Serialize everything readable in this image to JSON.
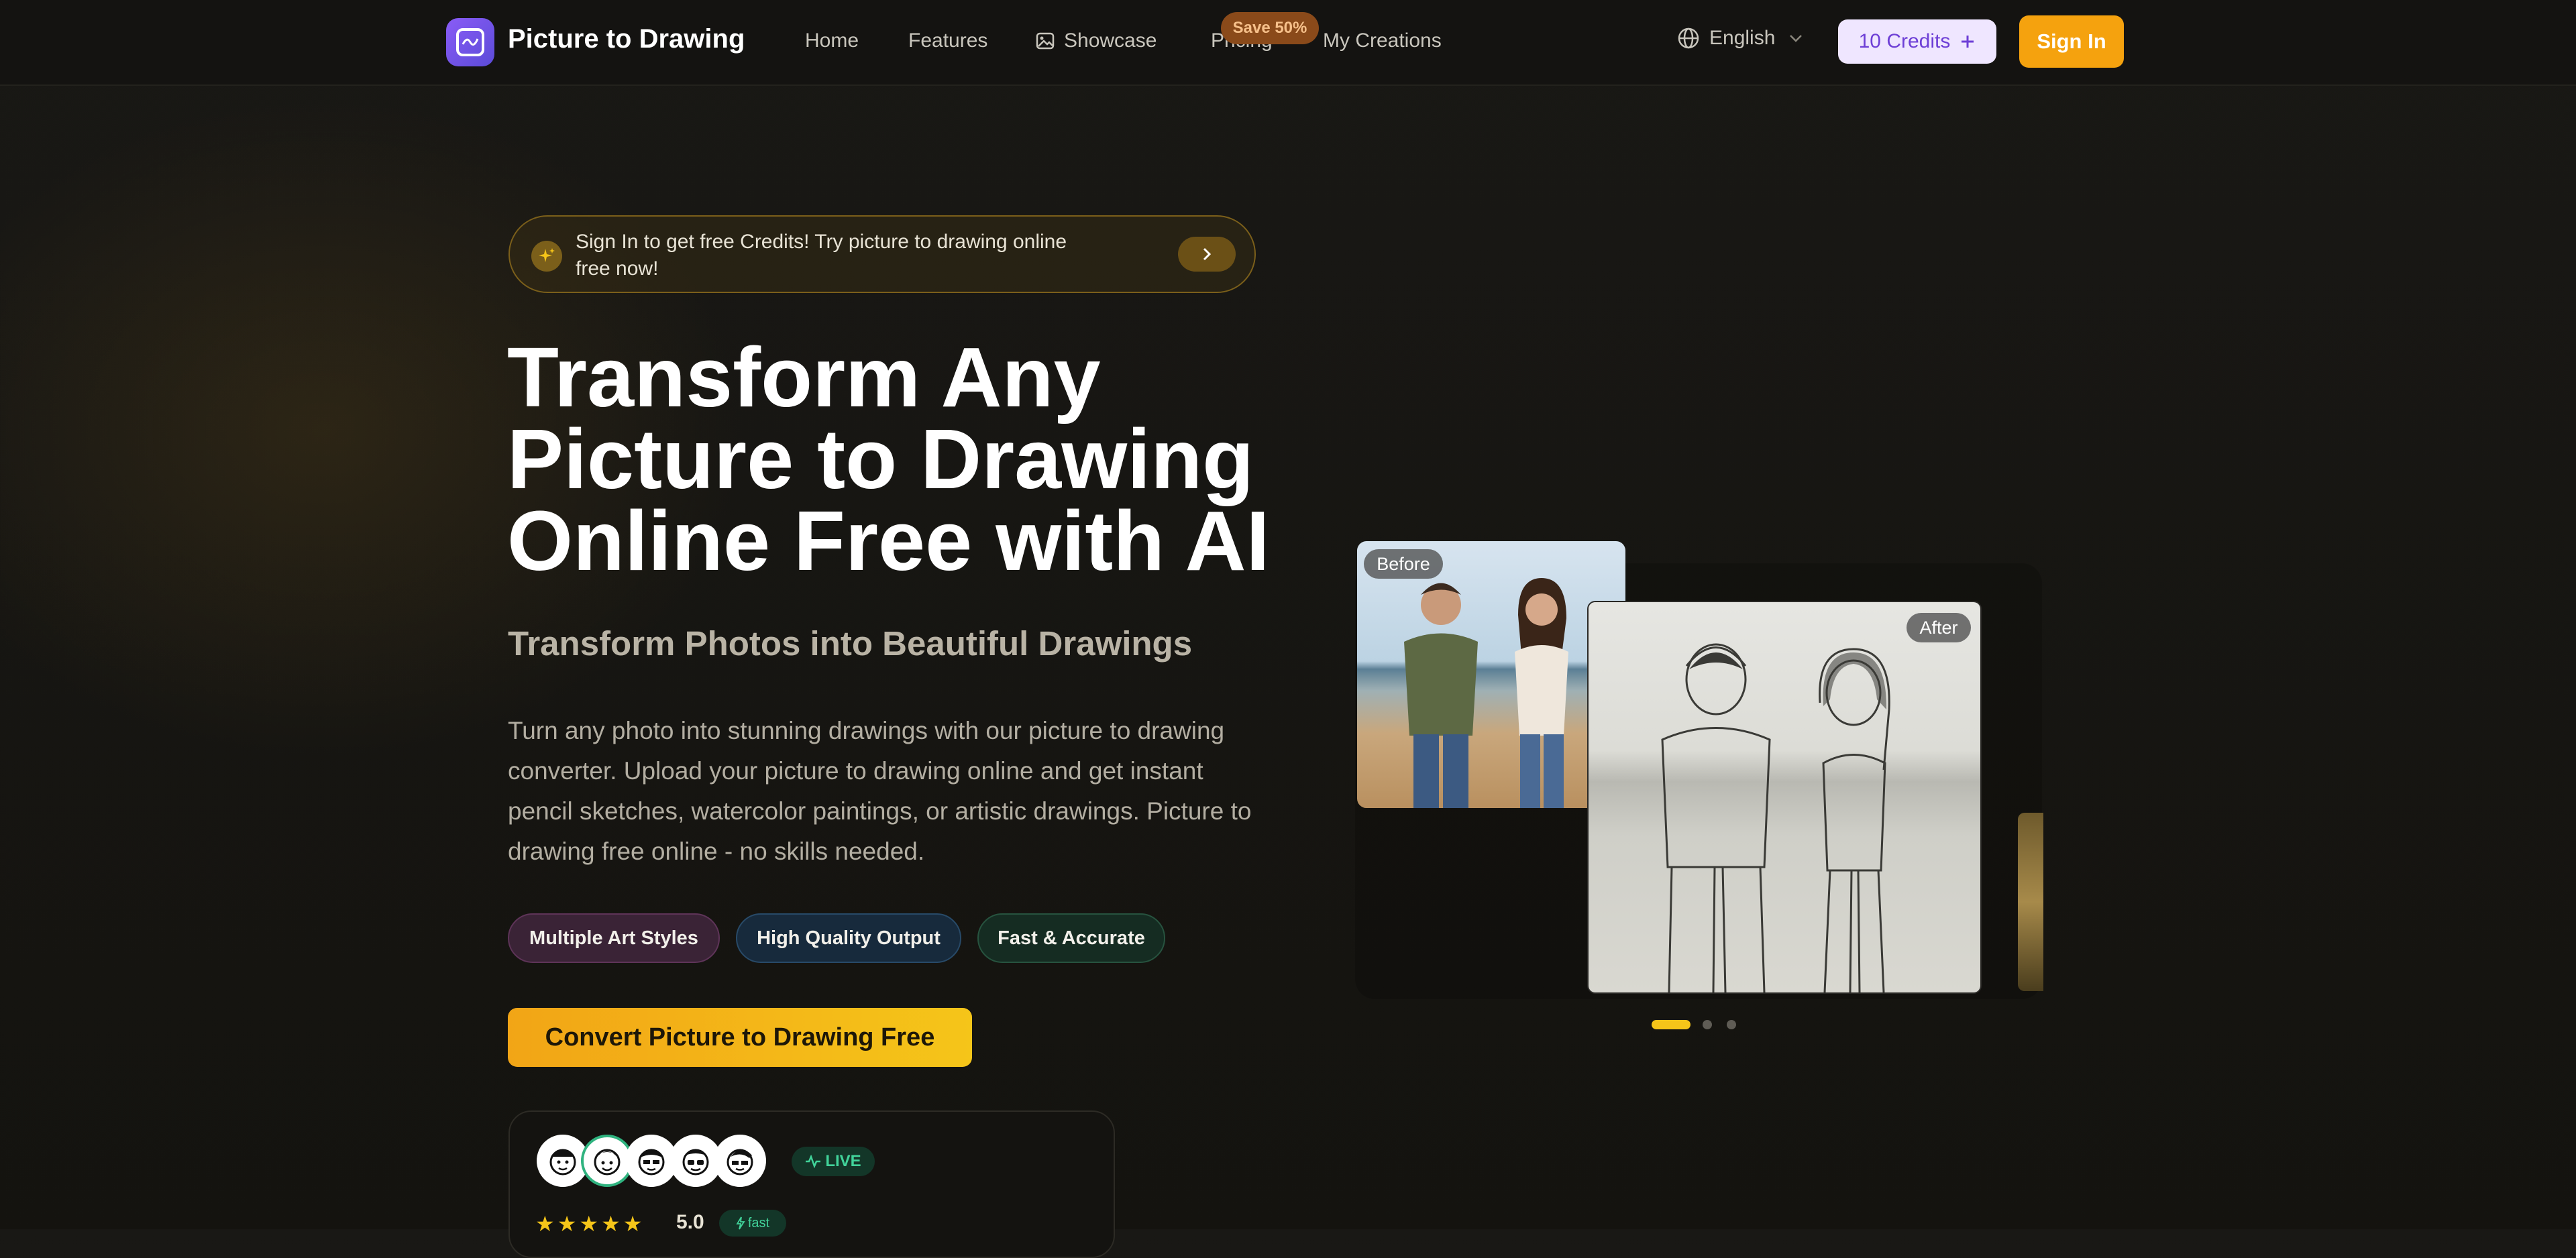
{
  "header": {
    "brand": "Picture to Drawing",
    "nav": [
      {
        "label": "Home"
      },
      {
        "label": "Features"
      },
      {
        "label": "Showcase"
      },
      {
        "label": "Pricing"
      },
      {
        "label": "My Creations"
      }
    ],
    "pricing_badge": "Save 50%",
    "language": "English",
    "credits_label": "10 Credits",
    "signin_label": "Sign In"
  },
  "promo": {
    "text": "Sign In to get free Credits! Try picture to drawing online free now!"
  },
  "hero": {
    "title_lines": [
      "Transform Any",
      "Picture to Drawing",
      "Online Free with AI"
    ],
    "subtitle": "Transform Photos into Beautiful Drawings",
    "description": "Turn any photo into stunning drawings with our picture to drawing converter. Upload your picture to drawing online and get instant pencil sketches, watercolor paintings, or artistic drawings. Picture to drawing free online - no skills needed.",
    "features": [
      {
        "label": "Multiple Art Styles"
      },
      {
        "label": "High Quality Output"
      },
      {
        "label": "Fast & Accurate"
      }
    ],
    "cta_label": "Convert Picture to Drawing Free"
  },
  "social_proof": {
    "live_label": "LIVE",
    "rating": "5.0",
    "stars": 5,
    "fast_label": "fast"
  },
  "showcase": {
    "before_label": "Before",
    "after_label": "After",
    "slides": 3,
    "active_slide": 1
  },
  "colors": {
    "accent": "#f5a20e",
    "cta_gradient_start": "#f2a516",
    "cta_gradient_end": "#f5c519",
    "credits_bg": "#efe6ff",
    "live_green": "#41d39a"
  }
}
